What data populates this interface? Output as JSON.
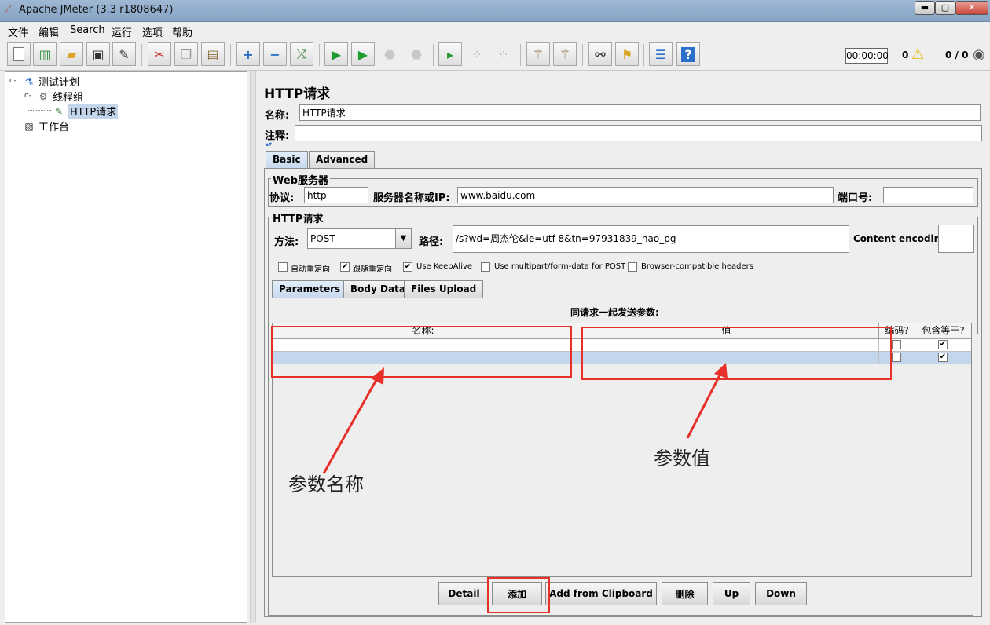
{
  "window": {
    "title": "Apache JMeter (3.3 r1808647)",
    "min_glyph": "▬",
    "max_glyph": "▢",
    "close_glyph": "✕"
  },
  "menu": [
    "文件",
    "编辑",
    "Search",
    "运行",
    "选项",
    "帮助"
  ],
  "toolbar": {
    "icons": [
      "new-icon",
      "templates-icon",
      "open-icon",
      "save-icon",
      "save-as-icon",
      "cut-icon",
      "copy-icon",
      "paste-icon",
      "expand-icon",
      "collapse-icon",
      "toggle-icon",
      "start-icon",
      "start-no-pause-icon",
      "stop-icon",
      "shutdown-icon",
      "remote-start-icon",
      "remote-stop-icon",
      "remote-shutdown-icon",
      "clear-icon",
      "clear-all-icon",
      "search-icon",
      "reset-search-icon",
      "function-helper-icon",
      "help-icon"
    ],
    "timer": "00:00:00",
    "warning_count": "0",
    "threads": "0 / 0"
  },
  "tree": {
    "test_plan": "测试计划",
    "thread_group": "线程组",
    "http_request": "HTTP请求",
    "workbench": "工作台"
  },
  "form": {
    "title": "HTTP请求",
    "name_label": "名称:",
    "name_value": "HTTP请求",
    "comment_label": "注释:",
    "comment_value": "",
    "tabs": [
      "Basic",
      "Advanced"
    ],
    "web_server_group": "Web服务器",
    "protocol_label": "协议:",
    "protocol_value": "http",
    "server_label": "服务器名称或IP:",
    "server_value": "www.baidu.com",
    "port_label": "端口号:",
    "port_value": "",
    "http_group": "HTTP请求",
    "method_label": "方法:",
    "method_value": "POST",
    "path_label": "路径:",
    "path_value": "/s?wd=周杰伦&ie=utf-8&tn=97931839_hao_pg",
    "encoding_label": "Content encoding:",
    "encoding_value": "",
    "options": [
      {
        "label": "自动重定向",
        "checked": false
      },
      {
        "label": "跟随重定向",
        "checked": true
      },
      {
        "label": "Use KeepAlive",
        "checked": true
      },
      {
        "label": "Use multipart/form-data for POST",
        "checked": false
      },
      {
        "label": "Browser-compatible headers",
        "checked": false
      }
    ],
    "param_tabs": [
      "Parameters",
      "Body Data",
      "Files Upload"
    ],
    "table_caption": "同请求一起发送参数:",
    "columns": [
      "名称:",
      "值",
      "编码?",
      "包含等于?"
    ],
    "rows": [
      {
        "name": "",
        "value": "",
        "encode": false,
        "include_equals": true
      },
      {
        "name": "",
        "value": "",
        "encode": false,
        "include_equals": true
      }
    ],
    "buttons": [
      "Detail",
      "添加",
      "Add from Clipboard",
      "删除",
      "Up",
      "Down"
    ]
  },
  "annotations": {
    "param_name": "参数名称",
    "param_value": "参数值"
  },
  "colors": {
    "annotation_red": "#e8302a",
    "selection_blue": "#c4d6ec"
  }
}
